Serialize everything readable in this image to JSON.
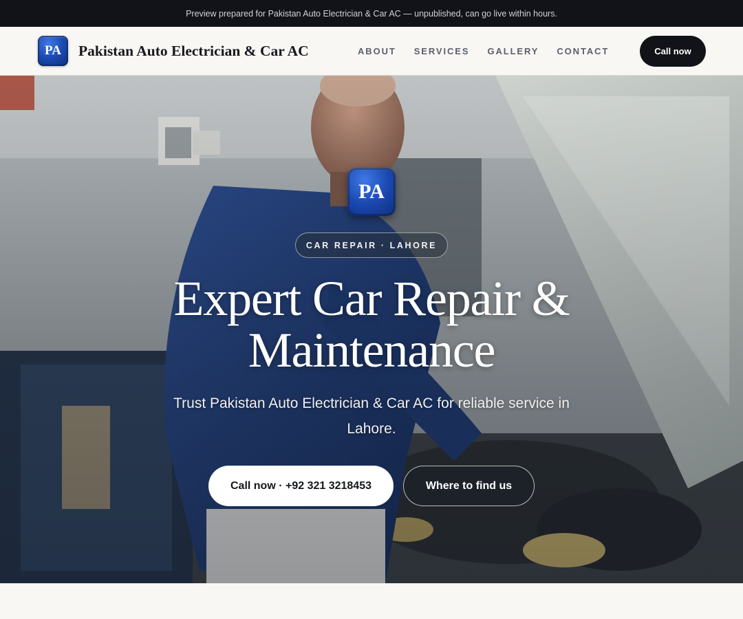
{
  "preview_banner": {
    "text": "Preview prepared for Pakistan Auto Electrician & Car AC — unpublished, can go live within hours."
  },
  "header": {
    "logo_text": "PA",
    "brand_name": "Pakistan Auto Electrician & Car AC",
    "nav": [
      {
        "label": "ABOUT"
      },
      {
        "label": "SERVICES"
      },
      {
        "label": "GALLERY"
      },
      {
        "label": "CONTACT"
      }
    ],
    "cta_label": "Call now"
  },
  "hero": {
    "logo_text": "PA",
    "badge": "CAR REPAIR · LAHORE",
    "title": "Expert Car Repair & Maintenance",
    "subtitle": "Trust Pakistan Auto Electrician & Car AC for reliable service in Lahore.",
    "primary_button": "Call now · +92 321 3218453",
    "secondary_button": "Where to find us"
  },
  "colors": {
    "topbar": "#111319",
    "page_bg": "#f8f7f4",
    "logo_blue": "#1a49b0",
    "dark_button": "#121318",
    "hero_text": "#ffffff"
  },
  "icons": {
    "hero_image": "mechanic-working-on-car-engine-photo"
  }
}
